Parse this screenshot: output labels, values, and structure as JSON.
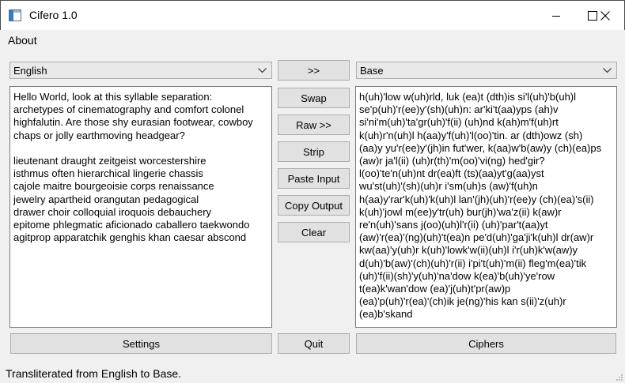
{
  "window": {
    "title": "Cifero 1.0",
    "icons": {
      "app": "window-app-icon",
      "minimize": "minimize-icon",
      "maximize": "maximize-icon",
      "close": "close-icon"
    }
  },
  "menu": {
    "about": "About"
  },
  "source": {
    "language": "English",
    "text": "Hello World, look at this syllable separation:\narchetypes of cinematography and comfort colonel\nhighfalutin. Are those shy eurasian footwear, cowboy\nchaps or jolly earthmoving headgear?\n\nlieutenant draught zeitgeist worcestershire\nisthmus often hierarchical lingerie chassis\ncajole maitre bourgeoisie corps renaissance\njewelry apartheid orangutan pedagogical\ndrawer choir colloquial iroquois debauchery\nepitome phlegmatic aficionado caballero taekwondo\nagitprop apparatchik genghis khan caesar abscond"
  },
  "target": {
    "language": "Base",
    "text": "h(uh)'low w(uh)rld, luk (ea)t (dth)is si'l(uh)'b(uh)l\nse'p(uh)'r(ee)y'(sh)(uh)n: ar'ki't(aa)yps (ah)v\nsi'ni'm(uh)'ta'gr(uh)'f(ii) (uh)nd k(ah)m'f(uh)rt\nk(uh)r'n(uh)l h(aa)y'f(uh)'l(oo)'tin. ar (dth)owz (sh)\n(aa)y yu'r(ee)y'(jh)in fut'wer, k(aa)w'b(aw)y (ch)(ea)ps\n(aw)r ja'l(ii) (uh)r(th)'m(oo)'vi(ng) hed'gir?\nl(oo)'te'n(uh)nt dr(ea)ft (ts)(aa)yt'g(aa)yst\nwu'st(uh)'(sh)(uh)r i'sm(uh)s (aw)'f(uh)n\nh(aa)y'rar'k(uh)'k(uh)l lan'(jh)(uh)'r(ee)y (ch)(ea)'s(ii)\nk(uh)'jowl m(ee)y'tr(uh) bur(jh)'wa'z(ii) k(aw)r\nre'n(uh)'sans j(oo)(uh)l'r(ii) (uh)'par't(aa)yt\n(aw)'r(ea)'(ng)(uh)'t(ea)n pe'd(uh)'ga'ji'k(uh)l dr(aw)r\nkw(aa)'y(uh)r k(uh)'lowk'w(ii)(uh)l i'r(uh)k'w(aw)y\nd(uh)'b(aw)'(ch)(uh)'r(ii) i'pi't(uh)'m(ii) fleg'm(ea)'tik\n(uh)'f(ii)(sh)'y(uh)'na'dow k(ea)'b(uh)'ye'row\nt(ea)k'wan'dow (ea)'j(uh)t'pr(aw)p\n(ea)'p(uh)'r(ea)'(ch)ik je(ng)'his kan s(ii)'z(uh)r\n(ea)b'skand"
  },
  "buttons": {
    "forward": ">>",
    "swap": "Swap",
    "raw": "Raw >>",
    "strip": "Strip",
    "paste_input": "Paste Input",
    "copy_output": "Copy Output",
    "clear": "Clear",
    "settings": "Settings",
    "quit": "Quit",
    "ciphers": "Ciphers"
  },
  "status": "Transliterated from English to Base."
}
